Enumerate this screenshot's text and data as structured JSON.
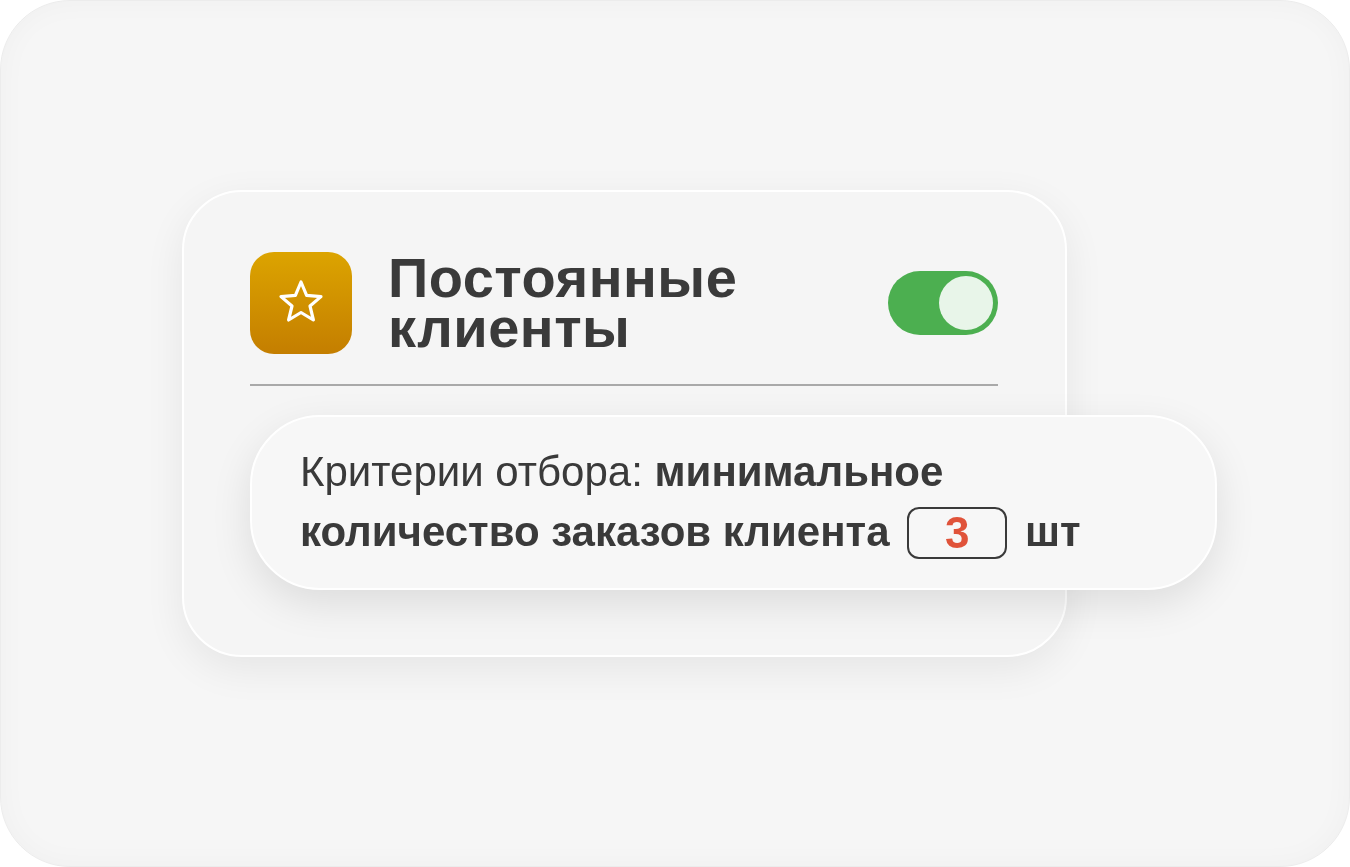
{
  "card": {
    "title": "Постоянные клиенты",
    "toggle": {
      "on": true
    }
  },
  "criteria": {
    "text": "Критерии отбора: **минимальное количество заказов клиента**",
    "field": {
      "value": "3"
    },
    "unit": "шт"
  }
}
